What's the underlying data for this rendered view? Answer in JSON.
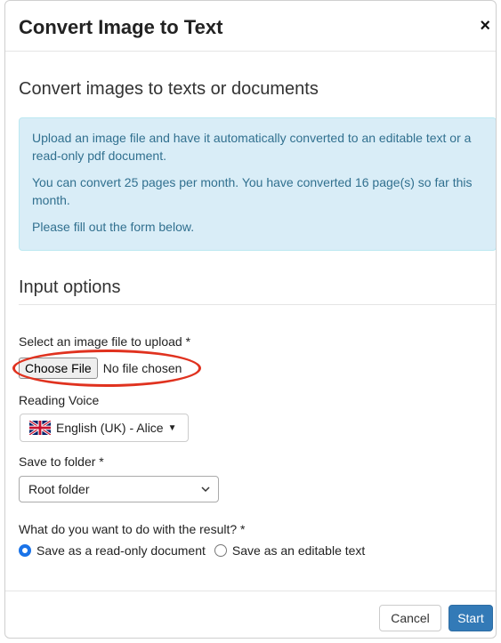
{
  "dialog": {
    "title": "Convert Image to Text",
    "close_glyph": "×",
    "subtitle": "Convert images to texts or documents"
  },
  "info": {
    "line1": "Upload an image file and have it automatically converted to an editable text or a read-only pdf document.",
    "line2": "You can convert 25 pages per month. You have converted 16 page(s) so far this month.",
    "line3": "Please fill out the form below.",
    "color": "#d9edf7"
  },
  "input_options": {
    "heading": "Input options",
    "file_label": "Select an image file to upload *",
    "file_button": "Choose File",
    "file_status": "No file chosen",
    "voice_label": "Reading Voice",
    "voice_value": "English (UK) - Alice",
    "voice_flag_icon": "uk-flag-icon",
    "folder_label": "Save to folder *",
    "folder_value": "Root folder",
    "result_label": "What do you want to do with the result? *",
    "option_readonly": "Save as a read-only document",
    "option_editable": "Save as an editable text",
    "selected_option": "readonly"
  },
  "annotation": {
    "highlight_color": "#e0321f"
  },
  "footer": {
    "cancel": "Cancel",
    "start": "Start",
    "primary_color": "#337ab7"
  }
}
